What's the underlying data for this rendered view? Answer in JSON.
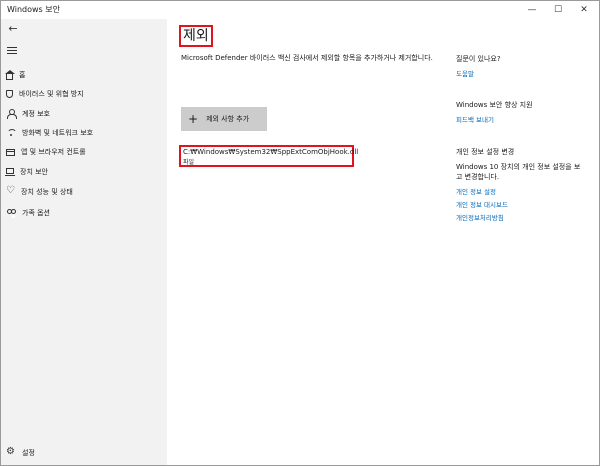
{
  "window": {
    "title": "Windows 보안",
    "minimize": "—",
    "maximize": "☐",
    "close": "✕"
  },
  "sidebar": {
    "back_icon": "back-arrow-icon",
    "menu_icon": "hamburger-menu-icon",
    "items": [
      {
        "label": "홈",
        "icon": "home-icon"
      },
      {
        "label": "바이러스 및 위협 방지",
        "icon": "shield-icon"
      },
      {
        "label": "계정 보호",
        "icon": "person-icon"
      },
      {
        "label": "방화벽 및 네트워크 보호",
        "icon": "wifi-icon"
      },
      {
        "label": "앱 및 브라우저 컨트롤",
        "icon": "app-window-icon"
      },
      {
        "label": "장치 보안",
        "icon": "laptop-icon"
      },
      {
        "label": "장치 성능 및 상태",
        "icon": "heart-icon"
      },
      {
        "label": "가족 옵션",
        "icon": "family-icon"
      }
    ],
    "settings": {
      "label": "설정",
      "icon": "gear-icon"
    }
  },
  "main": {
    "title": "제외",
    "description": "Microsoft Defender 바이러스 백신 검사에서 제외할 항목을 추가하거나 제거합니다.",
    "add_button": {
      "plus": "+",
      "label": "제외 사항 추가"
    },
    "exclusions": [
      {
        "path": "C:₩Windows₩System32₩SppExtComObjHook.dll",
        "type": "파일"
      }
    ]
  },
  "right_panel": {
    "question": {
      "heading": "질문이 있나요?",
      "link": "도움말"
    },
    "improve": {
      "heading": "Windows 보안 향상 지원",
      "link": "피드백 보내기"
    },
    "privacy": {
      "heading": "개인 정보 설정 변경",
      "text": "Windows 10 장치의 개인 정보 설정을 보고 변경합니다.",
      "links": [
        "개인 정보 설정",
        "개인 정보 대시보드",
        "개인정보처리방침"
      ]
    }
  }
}
